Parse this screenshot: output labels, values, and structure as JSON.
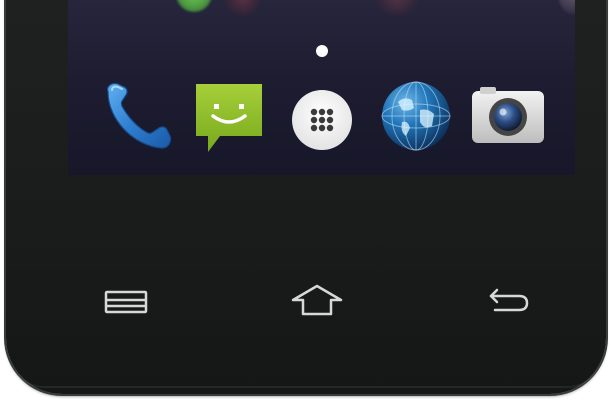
{
  "device": {
    "frame_color": "#1c1e1e",
    "wallpaper_color": "#23223a"
  },
  "home_screen": {
    "page_indicator": {
      "pages": 1,
      "active_page": 1
    },
    "dock": [
      {
        "id": "phone",
        "icon": "phone-handset-icon",
        "color": "#2f7fd0"
      },
      {
        "id": "messaging",
        "icon": "smiley-chat-bubble-icon",
        "color": "#8cbf26"
      },
      {
        "id": "apps",
        "icon": "app-drawer-dots-icon",
        "color": "#ffffff"
      },
      {
        "id": "browser",
        "icon": "globe-icon",
        "color": "#1d6aa8"
      },
      {
        "id": "camera",
        "icon": "camera-icon",
        "color": "#d8d8d8"
      }
    ]
  },
  "navigation_bar": {
    "buttons": [
      {
        "id": "menu",
        "icon": "menu-icon"
      },
      {
        "id": "home",
        "icon": "home-icon"
      },
      {
        "id": "back",
        "icon": "back-arrow-icon"
      }
    ],
    "icon_color": "#d7d9d9"
  }
}
